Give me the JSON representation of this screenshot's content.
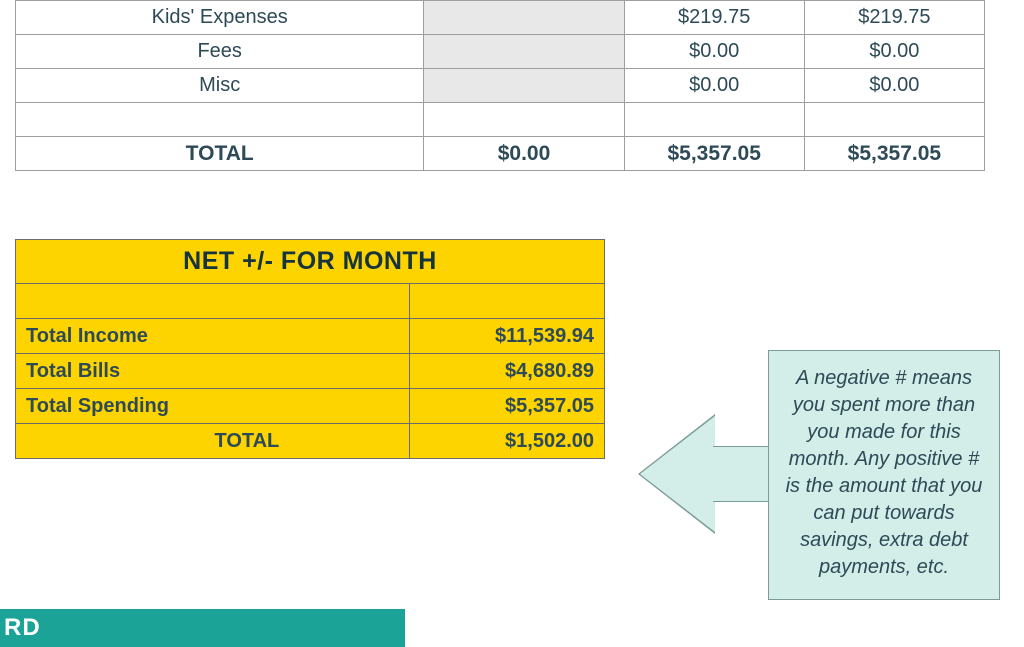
{
  "spending": {
    "rows": [
      {
        "label": "Kids' Expenses",
        "a": "",
        "b": "$219.75",
        "c": "$219.75",
        "grey": true
      },
      {
        "label": "Fees",
        "a": "",
        "b": "$0.00",
        "c": "$0.00",
        "grey": true
      },
      {
        "label": "Misc",
        "a": "",
        "b": "$0.00",
        "c": "$0.00",
        "grey": true
      }
    ],
    "total": {
      "label": "TOTAL",
      "a": "$0.00",
      "b": "$5,357.05",
      "c": "$5,357.05"
    }
  },
  "net": {
    "header": "NET +/- FOR MONTH",
    "rows": [
      {
        "label": "Total Income",
        "value": "$11,539.94"
      },
      {
        "label": "Total Bills",
        "value": "$4,680.89"
      },
      {
        "label": "Total Spending",
        "value": "$5,357.05"
      }
    ],
    "total": {
      "label": "TOTAL",
      "value": "$1,502.00"
    }
  },
  "callout_text": "A negative # means you spent more than you made for this month. Any positive # is the amount that you can put towards savings, extra debt payments, etc.",
  "bottom_tab": "RD"
}
